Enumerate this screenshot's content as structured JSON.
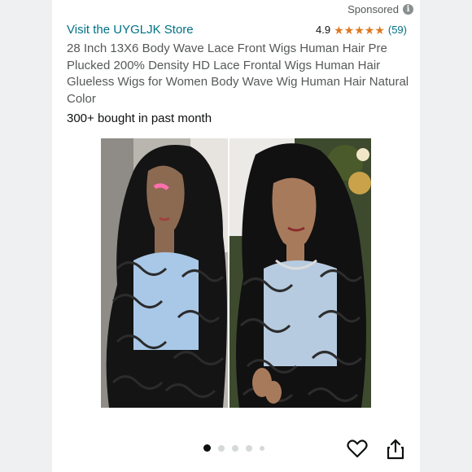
{
  "header": {
    "sponsored_label": "Sponsored",
    "info_glyph": "i"
  },
  "store": {
    "link_text": "Visit the UYGLJK Store"
  },
  "rating": {
    "value": "4.9",
    "stars": 5,
    "stars_filled": 4.9,
    "star_glyph": "★",
    "count_text": "(59)",
    "star_color": "#de7921"
  },
  "product": {
    "title": "28 Inch 13X6 Body Wave Lace Front Wigs Human Hair Pre Plucked 200% Density HD Lace Frontal Wigs Human Hair Glueless Wigs for Women Body Wave Wig Human Hair Natural Color",
    "bought_text": "300+ bought in past month"
  },
  "image": {
    "description_icon": "product-photo-wigs"
  },
  "carousel": {
    "total_dots": 5,
    "active_index": 0
  },
  "actions": {
    "wishlist_icon": "heart-icon",
    "share_icon": "share-icon"
  },
  "colors": {
    "link": "#007185",
    "text": "#0F1111",
    "muted": "#565959"
  }
}
